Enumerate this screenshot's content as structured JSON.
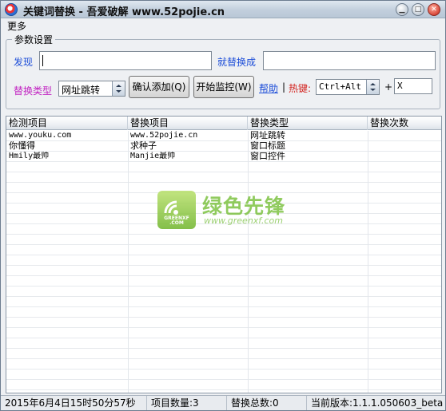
{
  "window": {
    "title": "关键词替换 - 吾爱破解 www.52pojie.cn"
  },
  "menu": {
    "more": "更多"
  },
  "params": {
    "group_title": "参数设置",
    "find_label": "发现",
    "find_value": "",
    "replace_label": "就替换成",
    "replace_value": "",
    "type_label": "替换类型",
    "type_selected": "网址跳转",
    "confirm_add": "确认添加(Q)",
    "start_monitor": "开始监控(W)",
    "help_link": "帮助",
    "separator": "|",
    "hotkey_label": "热键:",
    "hotkey_modifier": "Ctrl+Alt",
    "plus": "+",
    "hotkey_key": "X"
  },
  "table": {
    "columns": [
      "检测项目",
      "替换项目",
      "替换类型",
      "替换次数"
    ],
    "rows": [
      [
        "www.youku.com",
        "www.52pojie.cn",
        "网址跳转",
        ""
      ],
      [
        "你懂得",
        "求种子",
        "窗口标题",
        ""
      ],
      [
        "Hmily最帅",
        "Manjie最帅",
        "窗口控件",
        ""
      ]
    ]
  },
  "watermark": {
    "cn": "绿色先锋",
    "url": "www.greenxf.com",
    "badge": "GREENXF\n.COM"
  },
  "status": {
    "datetime": "2015年6月4日15时50分57秒",
    "item_count": "项目数量:3",
    "replace_total": "替换总数:0",
    "version": "当前版本:1.1.1.050603_beta"
  }
}
